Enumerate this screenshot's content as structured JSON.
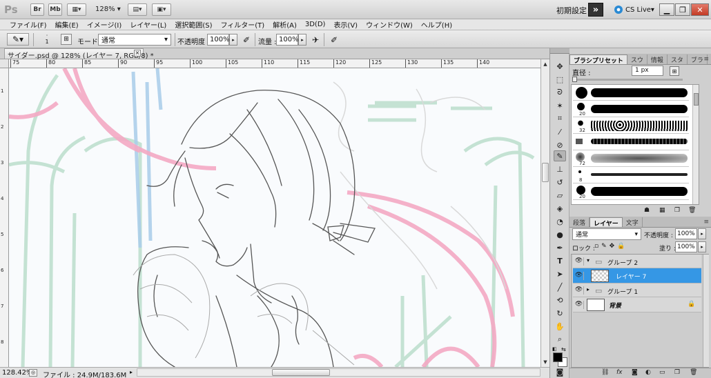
{
  "appbar": {
    "logo": "Ps",
    "bridge_icon": "Br",
    "minibridge_icon": "Mb",
    "zoom": "128%",
    "workspace": "初期設定",
    "more_button": "»",
    "cs_live": "CS Live▾"
  },
  "menu": [
    "ファイル(F)",
    "編集(E)",
    "イメージ(I)",
    "レイヤー(L)",
    "選択範囲(S)",
    "フィルター(T)",
    "解析(A)",
    "3D(D)",
    "表示(V)",
    "ウィンドウ(W)",
    "ヘルプ(H)"
  ],
  "options": {
    "brush_size": "1",
    "mode_label": "モード :",
    "mode_value": "通常",
    "opacity_label": "不透明度 :",
    "opacity_value": "100%",
    "flow_label": "流量 :",
    "flow_value": "100%"
  },
  "document": {
    "tab_title": "サイダー.psd @ 128% (レイヤー 7, RGB/8) *",
    "ruler_h": [
      "75",
      "80",
      "85",
      "90",
      "95",
      "100",
      "105",
      "110",
      "115",
      "120",
      "125",
      "130",
      "135",
      "140"
    ],
    "ruler_v": [
      "1",
      "2",
      "3",
      "4",
      "5",
      "6",
      "7",
      "8"
    ]
  },
  "status": {
    "zoom": "128.42%",
    "file": "ファイル : 24.9M/183.6M"
  },
  "brush_panel": {
    "tabs": [
      "ブラシプリセット",
      "スウ",
      "情報",
      "スタ",
      "ブラ"
    ],
    "diameter_label": "直径 :",
    "diameter_value": "1 px",
    "sizes": [
      "",
      "20",
      "32",
      "",
      "72",
      "8",
      "20"
    ]
  },
  "layers_panel": {
    "tabs": [
      "段落",
      "レイヤー",
      "文字"
    ],
    "blend_mode": "通常",
    "opacity_label": "不透明度 :",
    "opacity_value": "100%",
    "lock_label": "ロック :",
    "fill_label": "塗り :",
    "fill_value": "100%",
    "layers": [
      {
        "name": "グループ 2",
        "type": "group",
        "expanded": true
      },
      {
        "name": "レイヤー 7",
        "type": "layer",
        "selected": true
      },
      {
        "name": "グループ 1",
        "type": "group",
        "expanded": false
      },
      {
        "name": "背景",
        "type": "background",
        "locked": true
      }
    ]
  },
  "colors": {
    "selection": "#3597e5",
    "sketch_pink": "#f4a9c4",
    "sketch_green": "#bfe0cf",
    "sketch_blue": "#a9cdea"
  }
}
